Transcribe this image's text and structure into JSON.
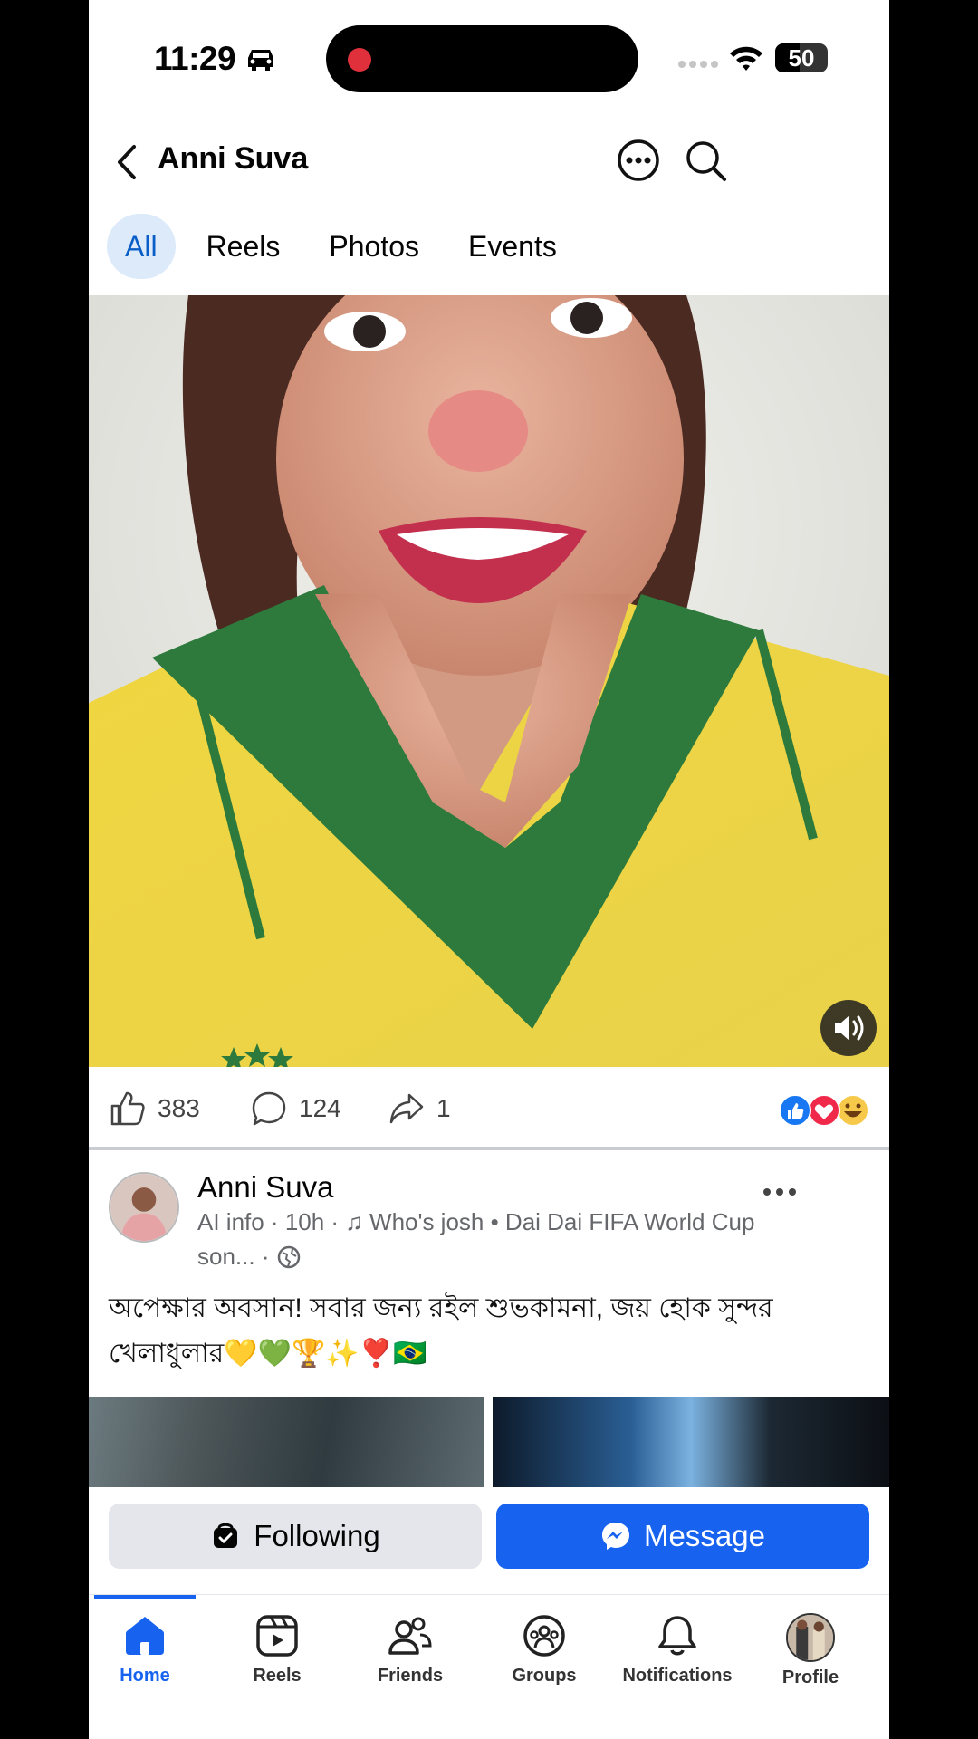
{
  "status_bar": {
    "time": "11:29",
    "battery": "50"
  },
  "header": {
    "title": "Anni Suva"
  },
  "tabs": [
    {
      "label": "All",
      "active": true
    },
    {
      "label": "Reels",
      "active": false
    },
    {
      "label": "Photos",
      "active": false
    },
    {
      "label": "Events",
      "active": false
    }
  ],
  "video": {
    "muted": false
  },
  "engagement": {
    "likes": "383",
    "comments": "124",
    "shares": "1"
  },
  "post": {
    "author": "Anni Suva",
    "meta_line1": "AI info · 10h · ♫ Who's josh • Dai Dai FIFA World Cup",
    "meta_line2": "son... ·",
    "caption": "অপেক্ষার অবসান! সবার জন্য রইল শুভকামনা, জয় হোক সুন্দর খেলাধুলার💛💚🏆✨❣️🇧🇷"
  },
  "actions": {
    "following_label": "Following",
    "message_label": "Message"
  },
  "nav": [
    {
      "label": "Home",
      "icon": "home-icon",
      "active": true
    },
    {
      "label": "Reels",
      "icon": "reels-icon",
      "active": false
    },
    {
      "label": "Friends",
      "icon": "friends-icon",
      "active": false
    },
    {
      "label": "Groups",
      "icon": "groups-icon",
      "active": false
    },
    {
      "label": "Notifications",
      "icon": "bell-icon",
      "active": false
    },
    {
      "label": "Profile",
      "icon": "profile-avatar",
      "active": false
    }
  ],
  "colors": {
    "accent": "#1763f0",
    "tab_active_bg": "#dceaf9",
    "tab_active_text": "#0a5ec7"
  }
}
